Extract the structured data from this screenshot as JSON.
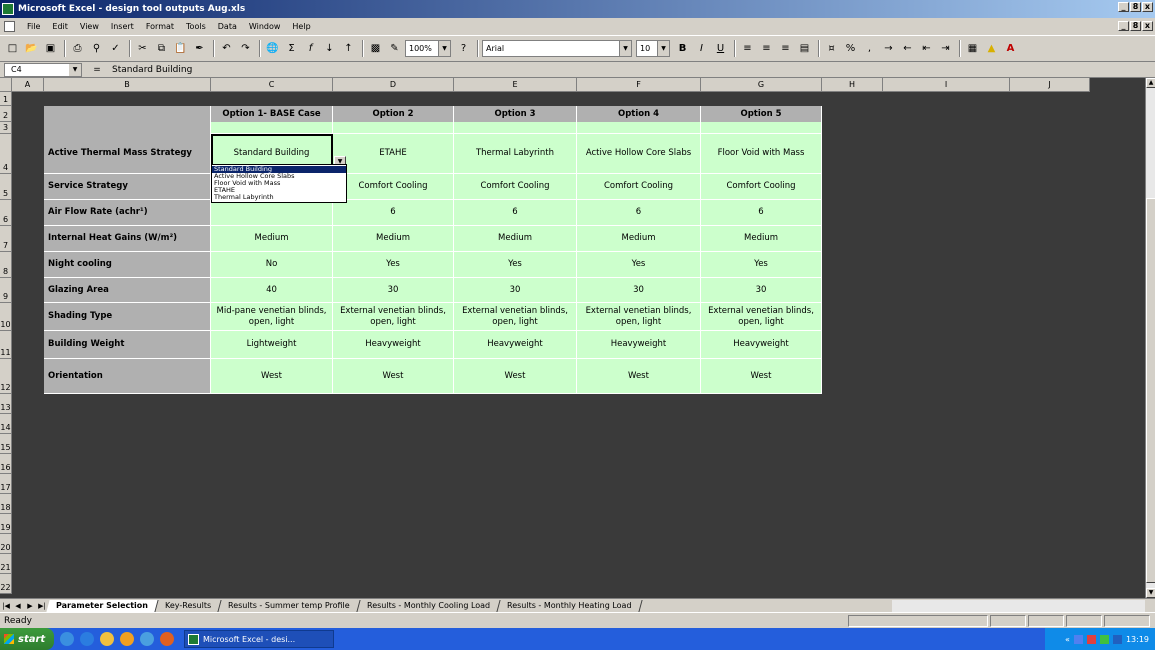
{
  "window": {
    "title": "Microsoft Excel - design tool outputs Aug.xls",
    "min": "_",
    "max": "8",
    "close": "x"
  },
  "menu": [
    "File",
    "Edit",
    "View",
    "Insert",
    "Format",
    "Tools",
    "Data",
    "Window",
    "Help"
  ],
  "toolbar": {
    "zoom": "100%",
    "font": "Arial",
    "size": "10",
    "bold": "B",
    "italic": "I",
    "underline": "U",
    "percent": "%",
    "comma": ","
  },
  "formula_bar": {
    "cell_ref": "C4",
    "eq": "=",
    "value": "Standard Building"
  },
  "columns": [
    "A",
    "B",
    "C",
    "D",
    "E",
    "F",
    "G",
    "H",
    "I",
    "J"
  ],
  "rows": [
    "1",
    "2",
    "3",
    "4",
    "5",
    "6",
    "7",
    "8",
    "9",
    "10",
    "11",
    "12",
    "13",
    "14",
    "15",
    "16",
    "17",
    "18",
    "19",
    "20",
    "21",
    "22"
  ],
  "table": {
    "headers": [
      "Option 1- BASE Case",
      "Option 2",
      "Option 3",
      "Option 4",
      "Option 5"
    ],
    "labels": [
      "Active Thermal Mass Strategy",
      "Service Strategy",
      "Air Flow Rate (achr¹)",
      "Internal Heat Gains (W/m²)",
      "Night cooling",
      "Glazing Area",
      "Shading Type",
      "Building Weight",
      "Orientation"
    ],
    "data": [
      [
        "Standard Building",
        "ETAHE",
        "Thermal Labyrinth",
        "Active Hollow Core Slabs",
        "Floor Void with Mass"
      ],
      [
        "",
        "Comfort Cooling",
        "Comfort Cooling",
        "Comfort Cooling",
        "Comfort Cooling"
      ],
      [
        "",
        "6",
        "6",
        "6",
        "6"
      ],
      [
        "Medium",
        "Medium",
        "Medium",
        "Medium",
        "Medium"
      ],
      [
        "No",
        "Yes",
        "Yes",
        "Yes",
        "Yes"
      ],
      [
        "40",
        "30",
        "30",
        "30",
        "30"
      ],
      [
        "Mid-pane venetian blinds, open, light",
        "External venetian blinds, open, light",
        "External venetian blinds, open, light",
        "External venetian blinds, open, light",
        "External venetian blinds, open, light"
      ],
      [
        "Lightweight",
        "Heavyweight",
        "Heavyweight",
        "Heavyweight",
        "Heavyweight"
      ],
      [
        "West",
        "West",
        "West",
        "West",
        "West"
      ]
    ]
  },
  "dropdown": {
    "options": [
      "Standard Building",
      "Active Hollow Core Slabs",
      "Floor Void with Mass",
      "ETAHE",
      "Thermal Labyrinth"
    ],
    "selected_index": 0
  },
  "sheet_tabs": [
    "Parameter Selection",
    "Key-Results",
    "Results - Summer temp Profile",
    "Results - Monthly Cooling Load",
    "Results - Monthly Heating Load"
  ],
  "status": "Ready",
  "taskbar": {
    "start": "start",
    "item": "Microsoft Excel - desi...",
    "clock": "13:19"
  }
}
